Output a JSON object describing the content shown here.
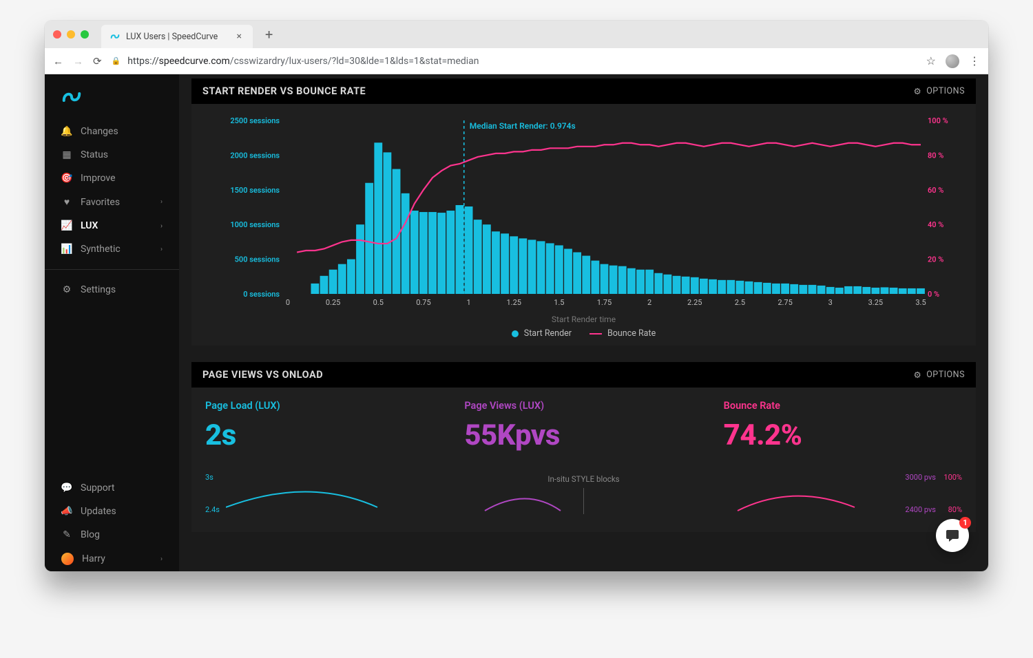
{
  "browser": {
    "tab_title": "LUX Users | SpeedCurve",
    "url_pre": "https://",
    "url_host": "speedcurve.com",
    "url_path": "/csswizardry/lux-users/?ld=30&lde=1&lds=1&stat=median"
  },
  "sidebar": {
    "nav": [
      {
        "icon": "bell-icon",
        "label": "Changes",
        "has_chev": false
      },
      {
        "icon": "grid-icon",
        "label": "Status",
        "has_chev": false
      },
      {
        "icon": "target-icon",
        "label": "Improve",
        "has_chev": false
      },
      {
        "icon": "heart-icon",
        "label": "Favorites",
        "has_chev": true
      },
      {
        "icon": "chart-icon",
        "label": "LUX",
        "has_chev": true,
        "active": true
      },
      {
        "icon": "bars-icon",
        "label": "Synthetic",
        "has_chev": true
      }
    ],
    "settings_label": "Settings",
    "footer": [
      {
        "icon": "chat-icon",
        "label": "Support"
      },
      {
        "icon": "megaphone-icon",
        "label": "Updates"
      },
      {
        "icon": "pencil-icon",
        "label": "Blog"
      }
    ],
    "user_label": "Harry"
  },
  "chart_panel": {
    "title": "START RENDER VS BOUNCE RATE",
    "options_label": "OPTIONS",
    "median_label": "Median Start Render: 0.974s",
    "xaxis_title": "Start Render time",
    "legend_bars": "Start Render",
    "legend_line": "Bounce Rate",
    "colors": {
      "bars": "#18bfe0",
      "line": "#ff348e",
      "ytick": "#18bfe0",
      "y2tick": "#ff348e"
    }
  },
  "chart_data": {
    "type": "bar+line",
    "title": "Start Render vs Bounce Rate",
    "xlabel": "Start Render time",
    "x_ticks": [
      0,
      0.25,
      0.5,
      0.75,
      1,
      1.25,
      1.5,
      1.75,
      2,
      2.25,
      2.5,
      2.75,
      3,
      3.25,
      3.5
    ],
    "series": [
      {
        "name": "Start Render (sessions)",
        "type": "bar",
        "x": [
          0.05,
          0.1,
          0.15,
          0.2,
          0.25,
          0.3,
          0.35,
          0.4,
          0.45,
          0.5,
          0.55,
          0.6,
          0.65,
          0.7,
          0.75,
          0.8,
          0.85,
          0.9,
          0.95,
          1.0,
          1.05,
          1.1,
          1.15,
          1.2,
          1.25,
          1.3,
          1.35,
          1.4,
          1.45,
          1.5,
          1.55,
          1.6,
          1.65,
          1.7,
          1.75,
          1.8,
          1.85,
          1.9,
          1.95,
          2.0,
          2.05,
          2.1,
          2.15,
          2.2,
          2.25,
          2.3,
          2.35,
          2.4,
          2.45,
          2.5,
          2.55,
          2.6,
          2.65,
          2.7,
          2.75,
          2.8,
          2.85,
          2.9,
          2.95,
          3.0,
          3.05,
          3.1,
          3.15,
          3.2,
          3.25,
          3.3,
          3.35,
          3.4,
          3.45,
          3.5
        ],
        "values": [
          0,
          0,
          150,
          260,
          350,
          430,
          500,
          1000,
          1600,
          2180,
          2040,
          1800,
          1450,
          1200,
          1180,
          1180,
          1170,
          1200,
          1280,
          1260,
          1070,
          1000,
          900,
          870,
          830,
          800,
          780,
          760,
          730,
          700,
          650,
          600,
          550,
          480,
          430,
          410,
          400,
          370,
          350,
          350,
          300,
          280,
          260,
          250,
          240,
          220,
          210,
          200,
          200,
          190,
          180,
          170,
          160,
          150,
          150,
          140,
          130,
          130,
          120,
          100,
          90,
          110,
          110,
          100,
          90,
          95,
          90,
          80,
          80,
          80
        ],
        "ylabel": "sessions",
        "ylim": [
          0,
          2500
        ],
        "yticks": [
          0,
          500,
          1000,
          1500,
          2000,
          2500
        ]
      },
      {
        "name": "Bounce Rate (%)",
        "type": "line",
        "x": [
          0.05,
          0.1,
          0.15,
          0.2,
          0.25,
          0.3,
          0.35,
          0.4,
          0.45,
          0.5,
          0.55,
          0.6,
          0.65,
          0.7,
          0.75,
          0.8,
          0.85,
          0.9,
          0.95,
          1.0,
          1.05,
          1.1,
          1.15,
          1.2,
          1.25,
          1.3,
          1.35,
          1.4,
          1.45,
          1.5,
          1.55,
          1.6,
          1.65,
          1.7,
          1.75,
          1.8,
          1.85,
          1.9,
          1.95,
          2.0,
          2.05,
          2.1,
          2.15,
          2.2,
          2.25,
          2.3,
          2.35,
          2.4,
          2.45,
          2.5,
          2.55,
          2.6,
          2.65,
          2.7,
          2.75,
          2.8,
          2.85,
          2.9,
          2.95,
          3.0,
          3.05,
          3.1,
          3.15,
          3.2,
          3.25,
          3.3,
          3.35,
          3.4,
          3.45,
          3.5
        ],
        "values": [
          24,
          25,
          25,
          26,
          28,
          30,
          31,
          31,
          30,
          29,
          29,
          32,
          41,
          52,
          60,
          67,
          71,
          74,
          75,
          77,
          79,
          80,
          81,
          81,
          82,
          82,
          83,
          83,
          84,
          84,
          84,
          85,
          85,
          85,
          86,
          86,
          87,
          87,
          86,
          86,
          85,
          86,
          87,
          87,
          86,
          85,
          86,
          87,
          87,
          86,
          85,
          86,
          87,
          87,
          86,
          85,
          86,
          87,
          86,
          85,
          86,
          87,
          87,
          86,
          85,
          86,
          87,
          87,
          86,
          86
        ],
        "ylabel": "%",
        "ylim": [
          0,
          100
        ],
        "yticks": [
          0,
          20,
          40,
          60,
          80,
          100
        ]
      }
    ],
    "median_x": 0.974
  },
  "second_panel": {
    "title": "PAGE VIEWS VS ONLOAD",
    "options_label": "OPTIONS",
    "kpis": [
      {
        "label": "Page Load (LUX)",
        "value": "2s",
        "cls": "k-blue"
      },
      {
        "label": "Page Views (LUX)",
        "value": "55Kpvs",
        "cls": "k-purple"
      },
      {
        "label": "Bounce Rate",
        "value": "74.2%",
        "cls": "k-pink"
      }
    ],
    "deploy_note": "In-situ STYLE blocks",
    "left_ticks": [
      "3s",
      "2.4s"
    ],
    "right_ticks_a": "3000 pvs",
    "right_ticks_b": "100%",
    "right_ticks_c": "2400 pvs",
    "right_ticks_d": "80%"
  },
  "chat_badge": "1"
}
